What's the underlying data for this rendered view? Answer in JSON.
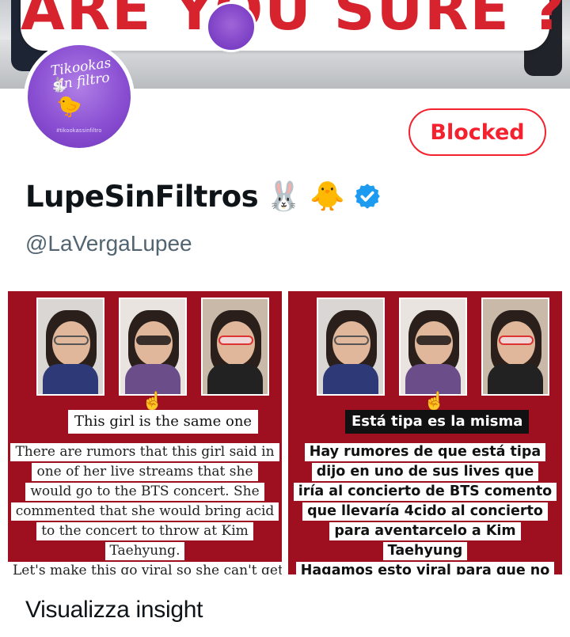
{
  "banner": {
    "headline": "ARE YOU SURE ?!"
  },
  "profile": {
    "display_name": "LupeSinFiltros",
    "emoji_1": "🐰",
    "emoji_2": "🐥",
    "handle": "@LaVergaLupee",
    "avatar_text": "Tikookas sin filtro",
    "avatar_small_text": "#tikookassinfiltro",
    "blocked_label": "Blocked"
  },
  "media": {
    "left": {
      "title": "This girl is the same one",
      "lines": [
        "There are rumors that this girl said in",
        "one of her live streams that she",
        "would go to the BTS concert. She",
        "commented that she would bring acid",
        "to the concert to throw at Kim",
        "Taehyung.",
        "Let's make this go viral so she can't get"
      ]
    },
    "right": {
      "title": "Está tipa es la misma",
      "lines": [
        "Hay rumores de que está tipa",
        "dijo en uno de sus lives que",
        "iría al concierto de BTS comento",
        "que llevaría 4cido al concierto",
        "para aventarcelo  a Kim",
        "Taehyung",
        "Hagamos esto viral para que no"
      ]
    },
    "pointer_emoji": "☝️"
  },
  "footer": {
    "insight_label": "Visualizza insight"
  },
  "colors": {
    "blocked_red": "#f4212e",
    "verified_blue": "#1d9bf0",
    "panel_red": "#9e0f1f",
    "handle_gray": "#536471"
  }
}
